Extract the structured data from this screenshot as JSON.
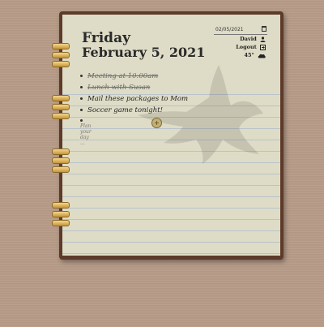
{
  "header": {
    "day_name": "Friday",
    "date": "February 5, 2021"
  },
  "date_picker": {
    "value": "02/05/2021"
  },
  "user": {
    "name": "David",
    "logout_label": "Logout",
    "temperature": "45°",
    "weather_icon": "cloud-icon",
    "user_icon": "person-icon",
    "logout_icon": "logout-icon"
  },
  "tasks": [
    {
      "text": "Meeting at 10:00am",
      "done": true
    },
    {
      "text": "Lunch with Susan",
      "done": true
    },
    {
      "text": "Mail these packages to Mom",
      "done": false
    },
    {
      "text": "Soccer game tonight!",
      "done": false
    }
  ],
  "new_task": {
    "placeholder": "Plan your day ...",
    "add_label": "+"
  },
  "colors": {
    "cover": "#5e3a2a",
    "paper": "#dedcc6",
    "rings": "#d9ad55",
    "background": "#b59a86"
  }
}
